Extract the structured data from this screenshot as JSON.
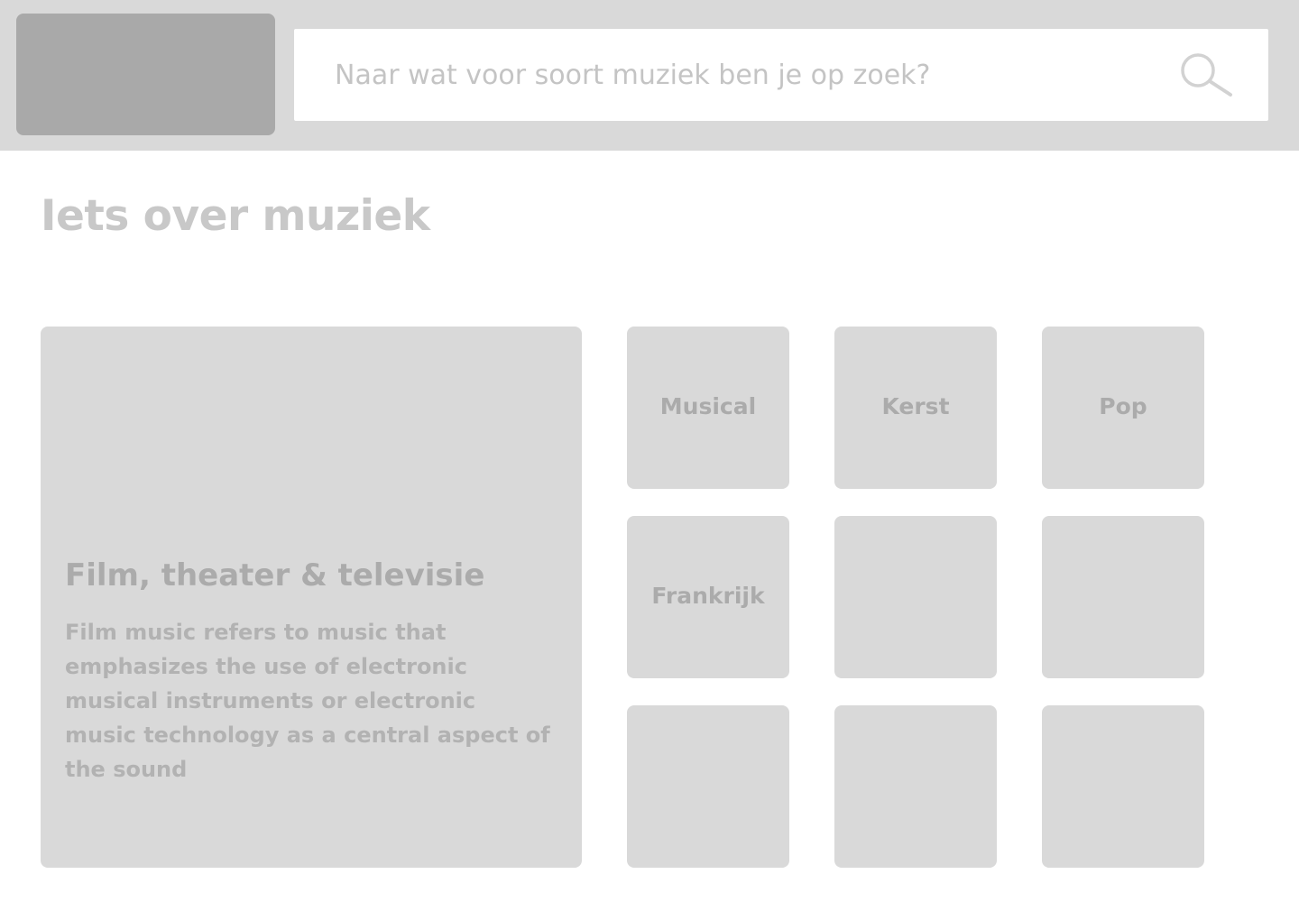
{
  "header": {
    "logo_label": "",
    "search": {
      "placeholder": "Naar wat voor soort muziek ben je op zoek?",
      "value": "",
      "icon": "search-icon"
    }
  },
  "main": {
    "title": "Iets over muziek",
    "feature": {
      "title": "Film, theater & televisie",
      "description": "Film music refers to music that emphasizes the use of electronic musical instruments or electronic music technology as a central aspect of the sound"
    },
    "genres": [
      {
        "label": "Musical"
      },
      {
        "label": "Kerst"
      },
      {
        "label": "Pop"
      },
      {
        "label": "Frankrijk"
      },
      {
        "label": ""
      },
      {
        "label": ""
      },
      {
        "label": ""
      },
      {
        "label": ""
      },
      {
        "label": ""
      }
    ]
  },
  "colors": {
    "header_bg": "#d9d9d9",
    "logo_bg": "#a9a9a9",
    "tile_bg": "#d9d9d9",
    "text_muted": "#ababab"
  }
}
